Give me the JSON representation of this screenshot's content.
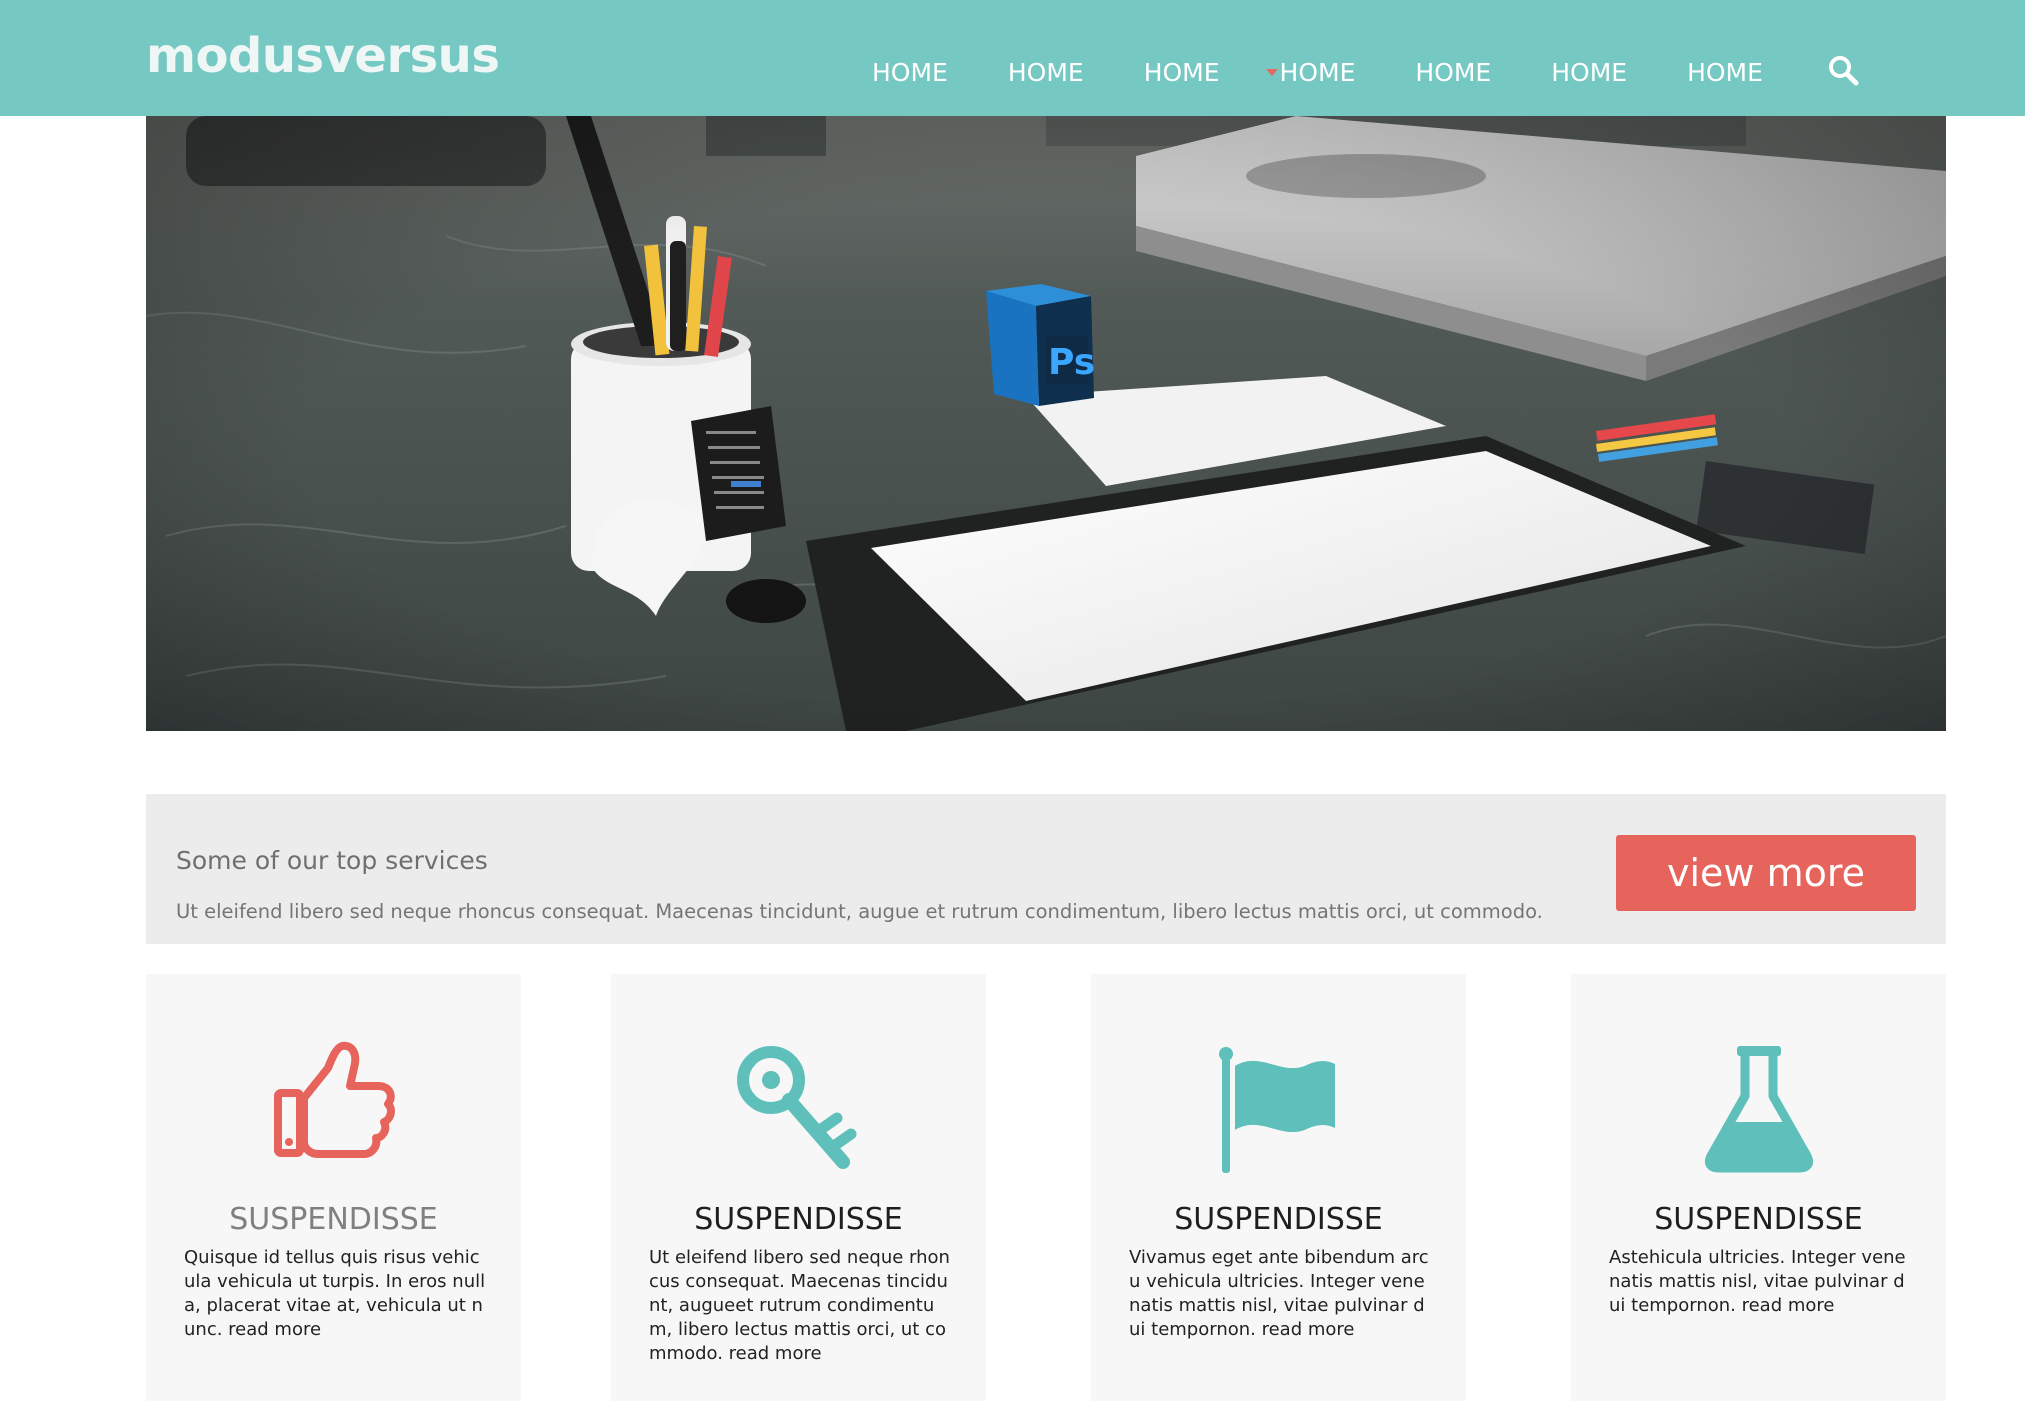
{
  "header": {
    "logo": "modusversus",
    "nav": [
      "HOME",
      "HOME",
      "HOME",
      "HOME",
      "HOME",
      "HOME",
      "HOME"
    ],
    "search_icon": "search-icon",
    "background_color": "#76c8c2"
  },
  "hero": {
    "image": "photo of designer desk with tablet, pencil cup and Photoshop cube",
    "cube_text": "Ps"
  },
  "banner": {
    "title": "Some of our top services",
    "text": "Ut eleifend libero sed neque rhoncus consequat. Maecenas tincidunt, augue et rutrum condimentum, libero lectus mattis orci, ut commodo.",
    "button_label": "view more",
    "button_color": "#e6645c"
  },
  "cards": [
    {
      "icon": "thumbs-up-icon",
      "icon_color": "#e6645c",
      "title": "SUSPENDISSE",
      "text": "Quisque id tellus quis risus vehicula vehicula ut turpis. In eros nulla, placerat vitae at, vehicula ut nunc. read more"
    },
    {
      "icon": "key-icon",
      "icon_color": "#5fbfba",
      "title": "SUSPENDISSE",
      "text": "Ut eleifend libero sed neque rhoncus consequat. Maecenas tincidunt, augueet rutrum condimentum, libero lectus mattis orci, ut commodo. read more"
    },
    {
      "icon": "flag-icon",
      "icon_color": "#5fbfba",
      "title": "SUSPENDISSE",
      "text": "Vivamus eget ante bibendum arcu vehicula ultricies. Integer venenatis mattis nisl, vitae pulvinar dui tempornon. read more"
    },
    {
      "icon": "flask-icon",
      "icon_color": "#5fbfba",
      "title": "SUSPENDISSE",
      "text": "Astehicula ultricies. Integer venenatis mattis nisl, vitae pulvinar dui tempornon. read more"
    }
  ]
}
